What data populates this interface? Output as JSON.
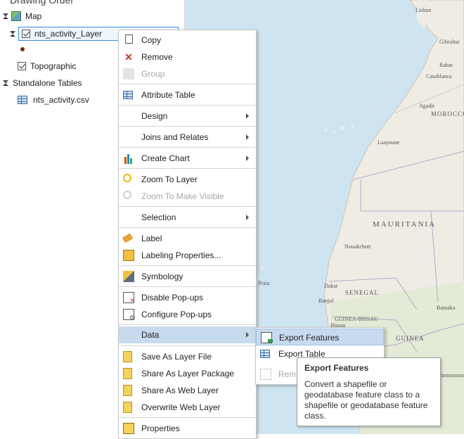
{
  "contents": {
    "title": "Drawing Order",
    "map_label": "Map",
    "layer_label": "nts_activity_Layer",
    "basemap_label": "Topographic",
    "standalone_tables_label": "Standalone Tables",
    "table_label": "nts_activity.csv"
  },
  "context_menu": {
    "items": [
      {
        "label": "Copy",
        "icon": "copy-icon"
      },
      {
        "label": "Remove",
        "icon": "remove-icon"
      },
      {
        "label": "Group",
        "icon": "group-icon",
        "disabled": true
      },
      {
        "label": "Attribute Table",
        "icon": "table-icon"
      },
      {
        "label": "Design",
        "submenu": true
      },
      {
        "label": "Joins and Relates",
        "submenu": true
      },
      {
        "label": "Create Chart",
        "icon": "chart-icon",
        "submenu": true
      },
      {
        "label": "Zoom To Layer",
        "icon": "zoom-icon"
      },
      {
        "label": "Zoom To Make Visible",
        "icon": "zoom-icon",
        "disabled": true
      },
      {
        "label": "Selection",
        "submenu": true
      },
      {
        "label": "Label",
        "icon": "label-icon"
      },
      {
        "label": "Labeling Properties...",
        "icon": "labeling-properties-icon"
      },
      {
        "label": "Symbology",
        "icon": "symbology-icon"
      },
      {
        "label": "Disable Pop-ups",
        "icon": "disable-popups-icon"
      },
      {
        "label": "Configure Pop-ups",
        "icon": "configure-popups-icon"
      },
      {
        "label": "Data",
        "submenu": true,
        "highlighted": true
      },
      {
        "label": "Save As Layer File",
        "icon": "layer-file-icon"
      },
      {
        "label": "Share As Layer Package",
        "icon": "layer-package-icon"
      },
      {
        "label": "Share As Web Layer",
        "icon": "web-layer-icon"
      },
      {
        "label": "Overwrite Web Layer",
        "icon": "overwrite-web-layer-icon"
      },
      {
        "label": "Properties",
        "icon": "properties-icon"
      }
    ]
  },
  "data_submenu": {
    "items": [
      {
        "label": "Export Features",
        "icon": "export-features-icon",
        "highlighted": true
      },
      {
        "label": "Export Table",
        "icon": "export-table-icon"
      },
      {
        "label": "Rema",
        "icon": "remap-icon",
        "disabled": true
      }
    ]
  },
  "tooltip": {
    "title": "Export Features",
    "body": "Convert a shapefile or geodatabase feature class to a shapefile or geodatabase feature class."
  },
  "map": {
    "labels": {
      "lisbon": "Lisbon",
      "gibraltar": "Gibraltar",
      "rabat": "Rabat",
      "casablanca": "Casablanca",
      "agadir": "Agadir",
      "morocco": "MOROCCO",
      "laayoune": "Laayoune",
      "mauritania": "MAURITANIA",
      "nouakchott": "Nouakchott",
      "praia": "Praia",
      "dakar": "Dakar",
      "senegal": "SENEGAL",
      "banjul": "Banjul",
      "guinea_bissau": "GUINEA-BISSAU",
      "bissau": "Bissau",
      "guinea": "GUINEA",
      "bamako": "Bamako",
      "yamoussoukro": "Yamoussoukro"
    }
  }
}
